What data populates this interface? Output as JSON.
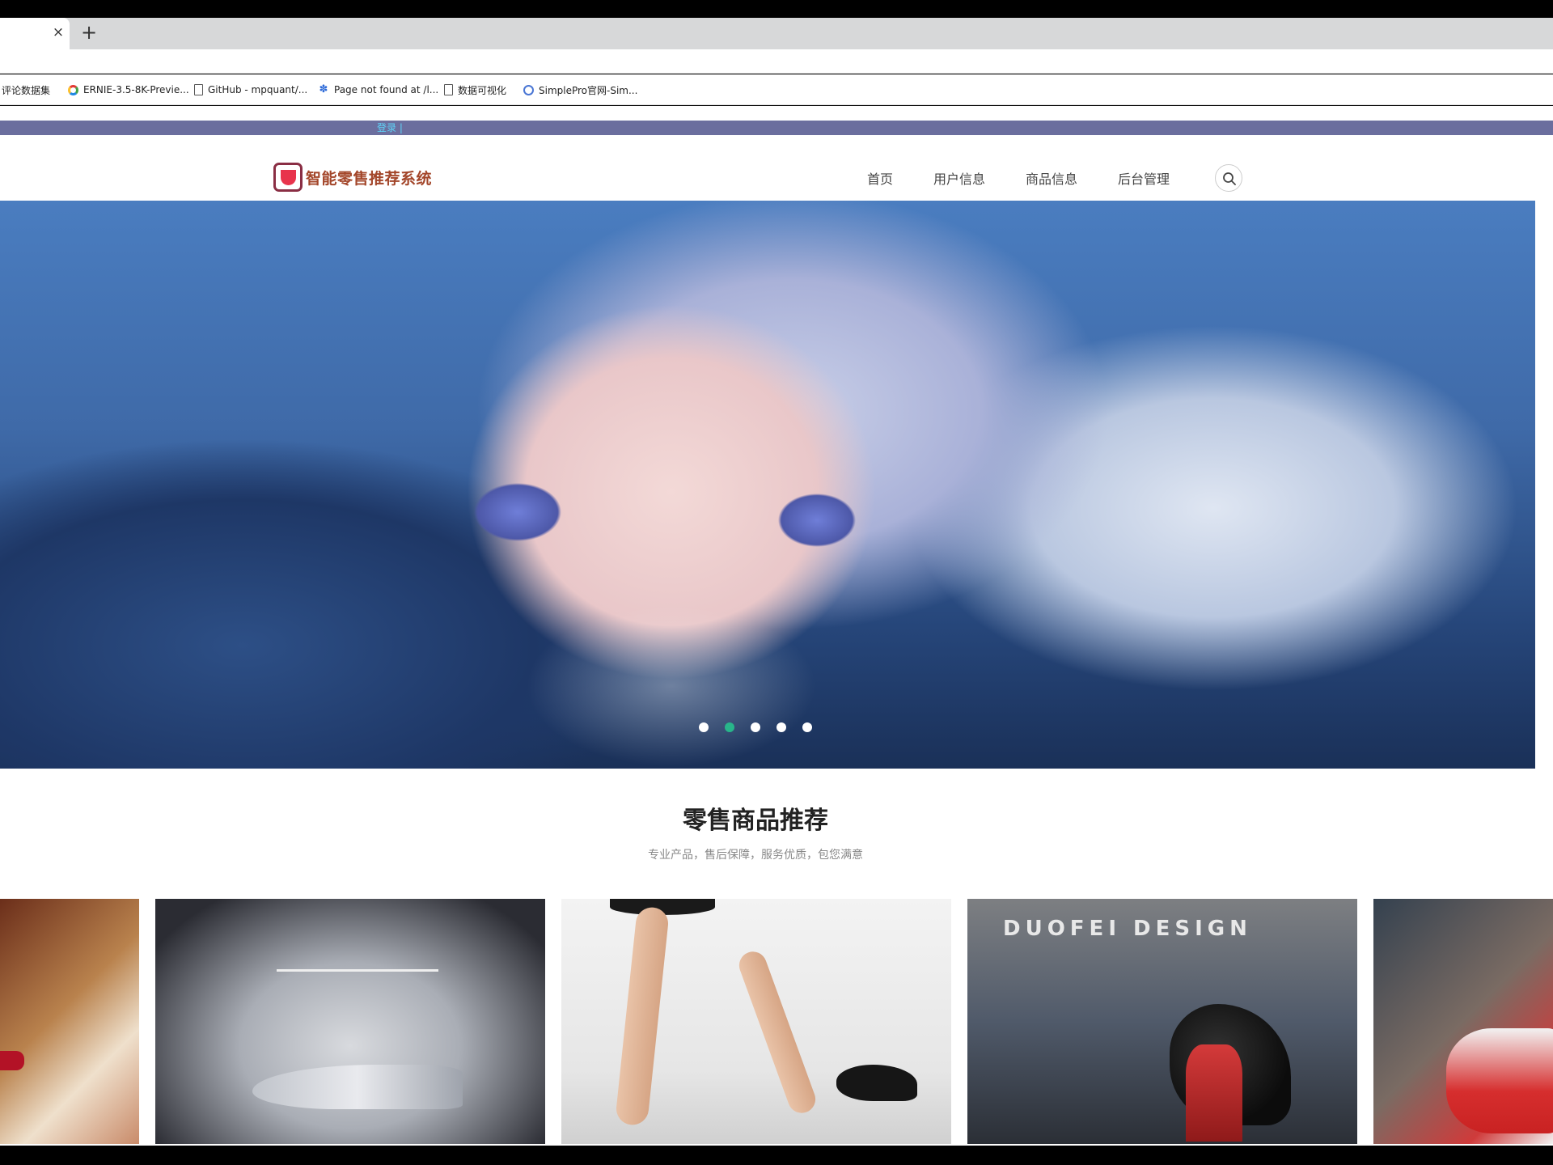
{
  "browser": {
    "tab_close": "×",
    "tab_new": "+",
    "bookmarks": [
      {
        "label": "评论数据集",
        "icon": "folder-icon"
      },
      {
        "label": "ERNIE-3.5-8K-Previe...",
        "icon": "ernie-icon"
      },
      {
        "label": "GitHub - mpquant/...",
        "icon": "page-icon"
      },
      {
        "label": "Page not found at /l...",
        "icon": "paw-icon"
      },
      {
        "label": "数据可视化",
        "icon": "page-icon"
      },
      {
        "label": "SimplePro官网-Sim...",
        "icon": "simplepro-icon"
      }
    ]
  },
  "site": {
    "login": "登录 |",
    "brand": "智能零售推荐系统",
    "nav": [
      "首页",
      "用户信息",
      "商品信息",
      "后台管理"
    ],
    "accent_color": "#28b58a",
    "topstrip_color": "#6b6e9e"
  },
  "carousel": {
    "slides": 5,
    "active_index": 1
  },
  "section": {
    "title": "零售商品推荐",
    "subtitle": "专业产品，售后保障，服务优质，包您满意"
  },
  "products": [
    {
      "brand_text": ""
    },
    {
      "brand_text": ""
    },
    {
      "brand_text": ""
    },
    {
      "brand_text": "DUOFEI DESIGN"
    },
    {
      "brand_text": ""
    }
  ]
}
